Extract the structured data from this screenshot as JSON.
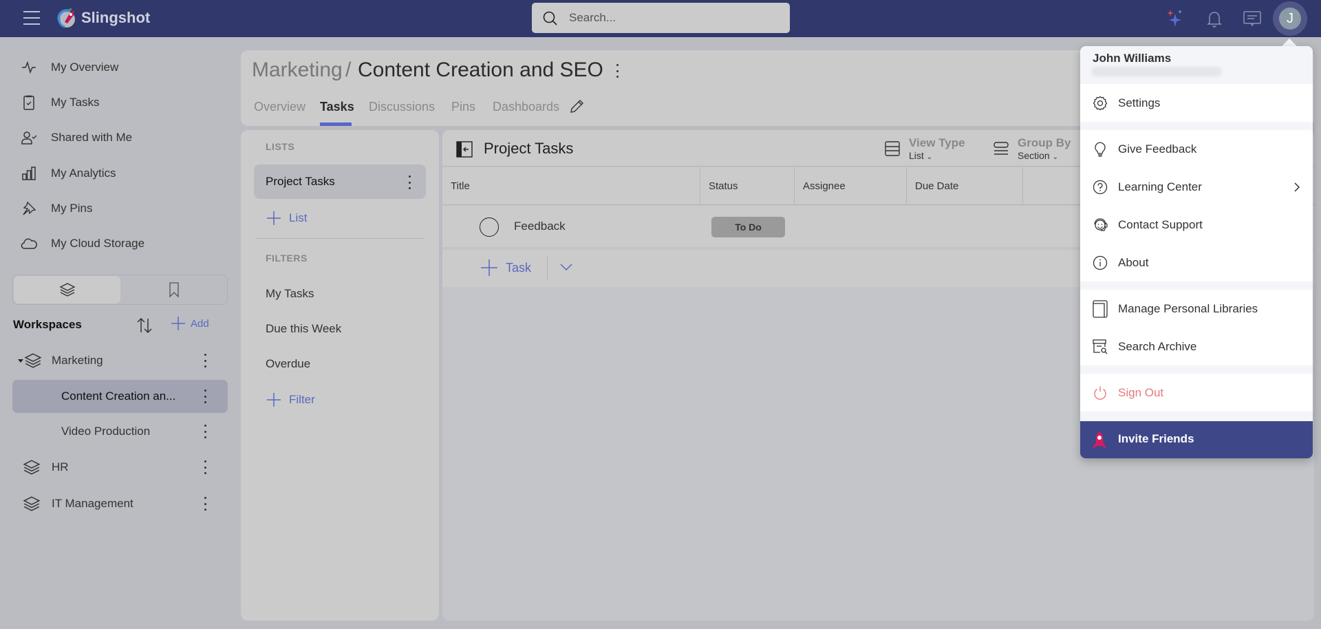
{
  "app": {
    "name": "Slingshot"
  },
  "topbar": {
    "search_placeholder": "Search...",
    "avatar_initial": "J",
    "icons": [
      "menu-icon",
      "sparkle-icon",
      "bell-icon",
      "chat-icon"
    ]
  },
  "sidebar": {
    "nav": [
      {
        "label": "My Overview",
        "icon": "activity-icon"
      },
      {
        "label": "My Tasks",
        "icon": "clipboard-check-icon"
      },
      {
        "label": "Shared with Me",
        "icon": "user-check-icon"
      },
      {
        "label": "My Analytics",
        "icon": "bar-chart-icon"
      },
      {
        "label": "My Pins",
        "icon": "pin-icon"
      },
      {
        "label": "My Cloud Storage",
        "icon": "cloud-icon"
      }
    ],
    "workspaces_title": "Workspaces",
    "add_label": "Add",
    "workspaces": [
      {
        "label": "Marketing",
        "expanded": true,
        "children": [
          {
            "label": "Content Creation an...",
            "selected": true
          },
          {
            "label": "Video Production",
            "selected": false
          }
        ]
      },
      {
        "label": "HR"
      },
      {
        "label": "IT Management"
      }
    ]
  },
  "header": {
    "breadcrumb_parent": "Marketing",
    "breadcrumb_separator": "/",
    "title": "Content Creation and SEO",
    "tabs": [
      {
        "label": "Overview",
        "active": false
      },
      {
        "label": "Tasks",
        "active": true
      },
      {
        "label": "Discussions",
        "active": false
      },
      {
        "label": "Pins",
        "active": false
      },
      {
        "label": "Dashboards",
        "active": false
      }
    ]
  },
  "lists_panel": {
    "lists_label": "LISTS",
    "lists": [
      {
        "label": "Project Tasks",
        "selected": true
      }
    ],
    "add_list_label": "List",
    "filters_label": "FILTERS",
    "filters": [
      "My Tasks",
      "Due this Week",
      "Overdue"
    ],
    "add_filter_label": "Filter"
  },
  "task_panel": {
    "title": "Project Tasks",
    "view_type": {
      "label": "View Type",
      "value": "List"
    },
    "group_by": {
      "label": "Group By",
      "value": "Section"
    },
    "columns": [
      "Title",
      "Status",
      "Assignee",
      "Due Date"
    ],
    "rows": [
      {
        "title": "Feedback",
        "status": "To Do",
        "assignee": "",
        "due_date": ""
      }
    ],
    "add_task_label": "Task"
  },
  "user_menu": {
    "name": "John Williams",
    "items": [
      {
        "label": "Settings",
        "icon": "gear-icon"
      },
      {
        "label": "Give Feedback",
        "icon": "lightbulb-icon"
      },
      {
        "label": "Learning Center",
        "icon": "help-circle-icon",
        "submenu": true
      },
      {
        "label": "Contact Support",
        "icon": "headset-icon"
      },
      {
        "label": "About",
        "icon": "info-icon"
      },
      {
        "label": "Manage Personal Libraries",
        "icon": "book-icon"
      },
      {
        "label": "Search Archive",
        "icon": "archive-search-icon"
      },
      {
        "label": "Sign Out",
        "icon": "power-icon"
      }
    ],
    "invite_label": "Invite Friends"
  },
  "colors": {
    "topbar": "#31386b",
    "accent": "#5866c4",
    "link": "#5a68c0",
    "sign_out": "#e8787a",
    "invite_bg": "#3e4889",
    "rocket": "#d81b60"
  }
}
